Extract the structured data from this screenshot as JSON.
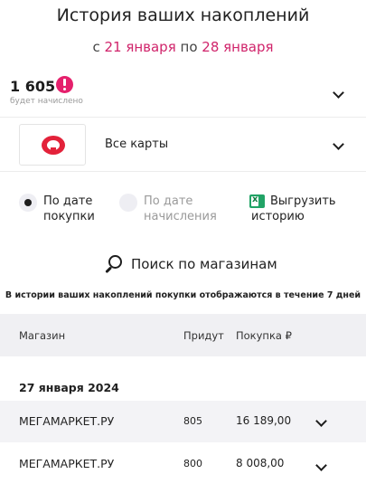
{
  "header": {
    "title": "История ваших накоплений",
    "period_prefix": "с",
    "period_start": "21 января",
    "period_middle": "по",
    "period_end": "28 января"
  },
  "balance": {
    "value": "1 605",
    "sub_label": "будет начислено",
    "icon": "exclamation-icon"
  },
  "cards": {
    "logo": "bank-card-logo",
    "label": "Все карты"
  },
  "sort_options": [
    {
      "line1": "По дате",
      "line2": "покупки",
      "selected": true
    },
    {
      "line1": "По дате",
      "line2": "начисления",
      "selected": false
    }
  ],
  "export": {
    "line1": "Выгрузить",
    "line2": "историю",
    "icon": "excel-icon"
  },
  "search": {
    "label": "Поиск по магазинам",
    "icon": "search-icon"
  },
  "note": "В истории ваших накоплений покупки отображаются в течение 7 дней",
  "table": {
    "columns": [
      "Магазин",
      "Придут",
      "Покупка ₽"
    ],
    "groups": [
      {
        "date": "27 января 2024",
        "rows": [
          {
            "store": "МЕГАМАРКЕТ.РУ",
            "points": "805",
            "amount": "16 189,00"
          },
          {
            "store": "МЕГАМАРКЕТ.РУ",
            "points": "800",
            "amount": "8 008,00"
          }
        ]
      }
    ]
  },
  "colors": {
    "accent_pink": "#d0246b",
    "alert": "#e5206c",
    "header_bg": "#f0f0f3"
  }
}
